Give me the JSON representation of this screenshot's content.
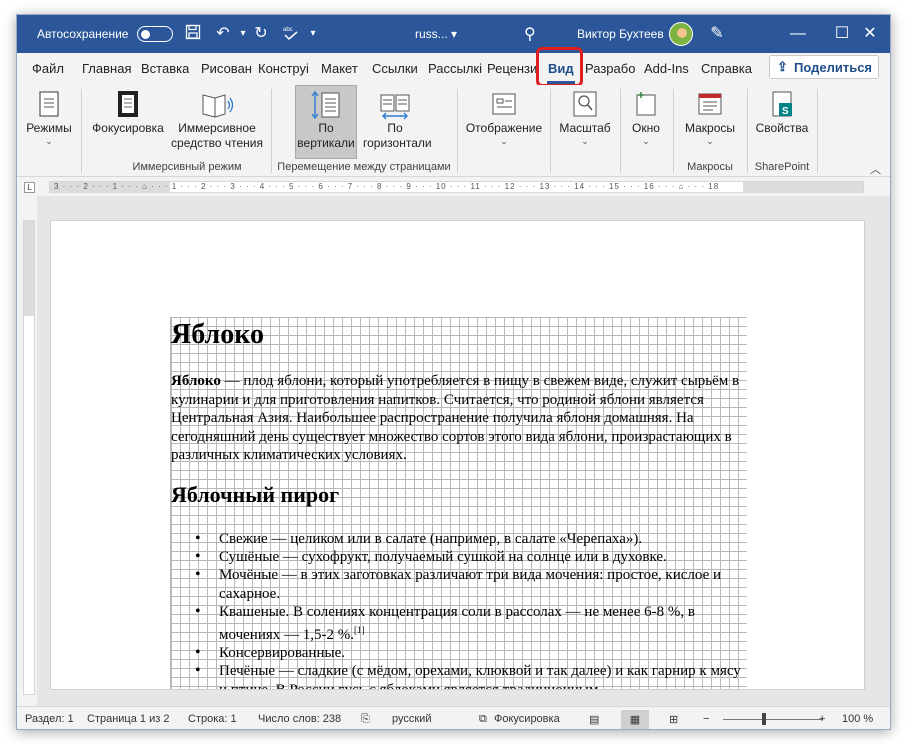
{
  "titlebar": {
    "autosave_label": "Автосохранение",
    "doc_title": "russ... ▾",
    "username": "Виктор Бухтеев",
    "undo_chevron": "▾",
    "more_chevron": "▾",
    "minimize": "—",
    "maximize": "☐",
    "close": "✕"
  },
  "tabs": [
    {
      "label": "Файл"
    },
    {
      "label": "Главная"
    },
    {
      "label": "Вставка"
    },
    {
      "label": "Рисован"
    },
    {
      "label": "Конструі"
    },
    {
      "label": "Макет"
    },
    {
      "label": "Ссылки"
    },
    {
      "label": "Рассылкі"
    },
    {
      "label": "Рецензи"
    },
    {
      "label": "Вид"
    },
    {
      "label": "Разрабо"
    },
    {
      "label": "Add-Ins"
    },
    {
      "label": "Справка"
    }
  ],
  "share_label": "Поделиться",
  "ribbon": {
    "modes_label": "Режимы",
    "focus_label": "Фокусировка",
    "immersive_reader_line1": "Иммерсивное",
    "immersive_reader_line2": "средство чтения",
    "vertical_line1": "По",
    "vertical_line2": "вертикали",
    "horizontal_line1": "По",
    "horizontal_line2": "горизонтали",
    "display_label": "Отображение",
    "zoom_label": "Масштаб",
    "window_label": "Окно",
    "macros_label": "Макросы",
    "properties_label": "Свойства",
    "group_immersive": "Иммерсивный режим",
    "group_page_movement": "Перемещение между страницами",
    "group_macros": "Макросы",
    "group_sharepoint": "SharePoint",
    "chev": "⌄",
    "collapse": "︿"
  },
  "ruler": {
    "corner": "L",
    "marks": "3 · · · 2 · · · 1 · · · ⌂ · · · 1 · · · 2 · · · 3 · · · 4 · · · 5 · · · 6 · · · 7 · · · 8 · · · 9 · · · 10 · · · 11 · · · 12 · · · 13 · · · 14 · · · 15 · · · 16 · · · ⌂ · · · 18"
  },
  "document": {
    "heading1": "Яблоко",
    "para_bold": "Яблоко",
    "para_rest": " — плод яблони, который употребляется в пищу в свежем виде, служит сырьём в кулинарии и для приготовления напитков. Считается, что родиной яблони является Центральная Азия. Наибольшее распространение получила яблоня домашняя. На сегодняшний день существует множество сортов этого вида яблони, произрастающих в различных климатических условиях.",
    "heading2": "Яблочный пирог",
    "list": [
      "Свежие — целиком или в салате (например, в салате «Черепаха»).",
      "Сушёные — сухофрукт, получаемый сушкой на солнце или в духовке.",
      "Мочёные — в этих заготовках различают три вида мочения: простое, кислое и сахарное.",
      "Квашеные. В солениях концентрация соли в рассолах — не менее 6-8 %, в мочениях — 1,5-2 %.",
      "Консервированные.",
      "Печёные — сладкие (с мёдом, орехами, клюквой и так далее) и как гарнир к мясу и птице. В России гусь с яблоками является традиционным"
    ],
    "footnote": "[1]"
  },
  "statusbar": {
    "section": "Раздел: 1",
    "page": "Страница 1 из 2",
    "line": "Строка: 1",
    "words": "Число слов: 238",
    "language": "русский",
    "focus": "Фокусировка",
    "zoom_minus": "−",
    "zoom_plus": "+",
    "zoom_level": "100 %"
  },
  "zoom_percent": 100
}
